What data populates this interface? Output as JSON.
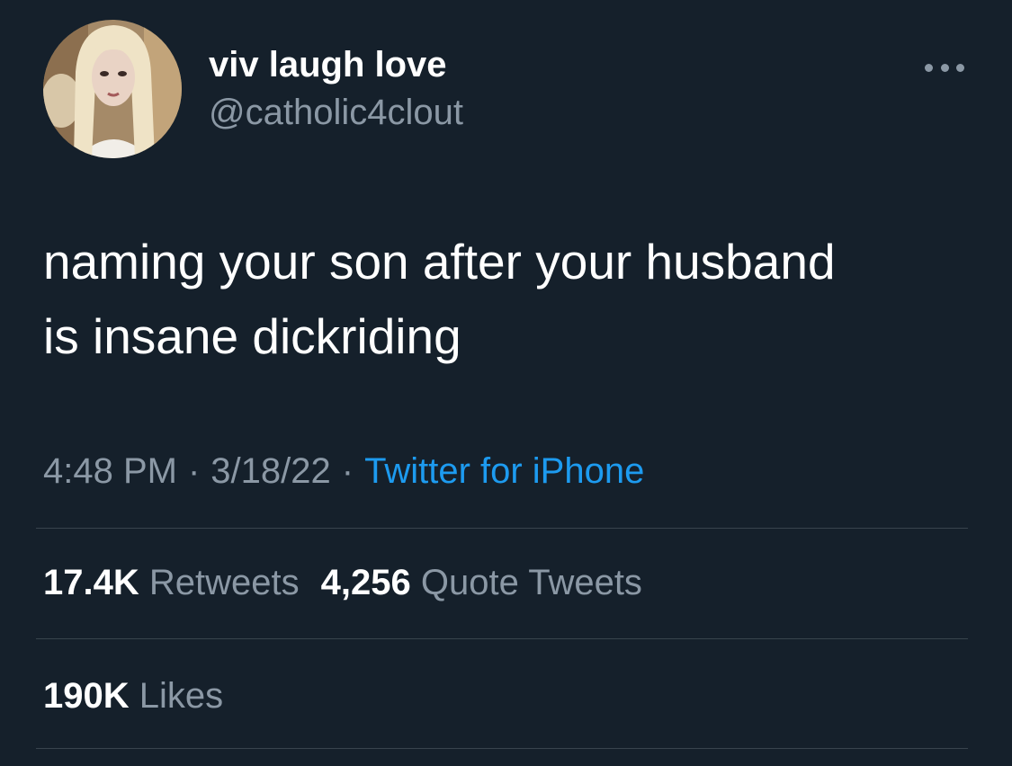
{
  "author": {
    "name": "viv laugh love",
    "handle": "@catholic4clout"
  },
  "tweet": {
    "text": "naming your son after your husband\nis insane dickriding"
  },
  "meta": {
    "time": "4:48 PM",
    "date": "3/18/22",
    "separator": "·",
    "source": "Twitter for iPhone"
  },
  "stats": {
    "retweets_count": "17.4K",
    "retweets_label": "Retweets",
    "quote_count": "4,256",
    "quote_label": "Quote Tweets",
    "likes_count": "190K",
    "likes_label": "Likes"
  },
  "icons": {
    "more": "more-horizontal-icon"
  },
  "colors": {
    "background": "#15202b",
    "primary_text": "#ffffff",
    "secondary_text": "#8b98a5",
    "link": "#1d9bf0",
    "divider": "#38444d"
  }
}
